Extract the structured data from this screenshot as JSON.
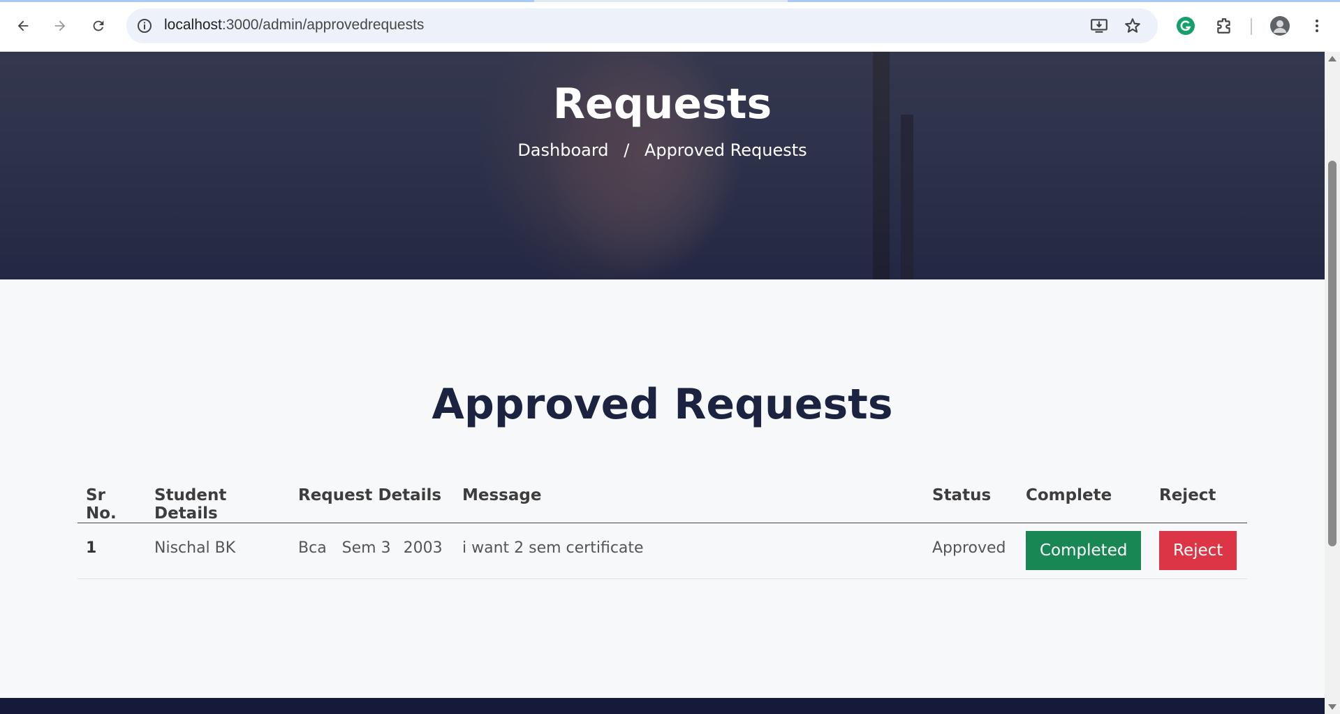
{
  "browser": {
    "url_host": "localhost",
    "url_path": ":3000/admin/approvedrequests",
    "icons": [
      "back-icon",
      "forward-icon",
      "reload-icon",
      "info-icon",
      "install-icon",
      "star-icon",
      "grammarly-icon",
      "extensions-icon",
      "profile-avatar",
      "menu-icon"
    ]
  },
  "hero": {
    "title": "Requests",
    "breadcrumb": {
      "home": "Dashboard",
      "separator": "/",
      "current": "Approved Requests"
    }
  },
  "main": {
    "heading": "Approved Requests",
    "table": {
      "headers": [
        "Sr No.",
        "Student Details",
        "Request Details",
        "Message",
        "Status",
        "Complete",
        "Reject"
      ],
      "rows": [
        {
          "sr": "1",
          "student": "Nischal BK",
          "course": "Bca",
          "semester": "Sem 3",
          "year": "2003",
          "message": "i want 2 sem certificate",
          "status": "Approved",
          "complete_label": "Completed",
          "reject_label": "Reject"
        }
      ]
    }
  },
  "colors": {
    "success": "#198754",
    "danger": "#dc3545",
    "heading": "#1c2340",
    "footer": "#161a3a"
  }
}
